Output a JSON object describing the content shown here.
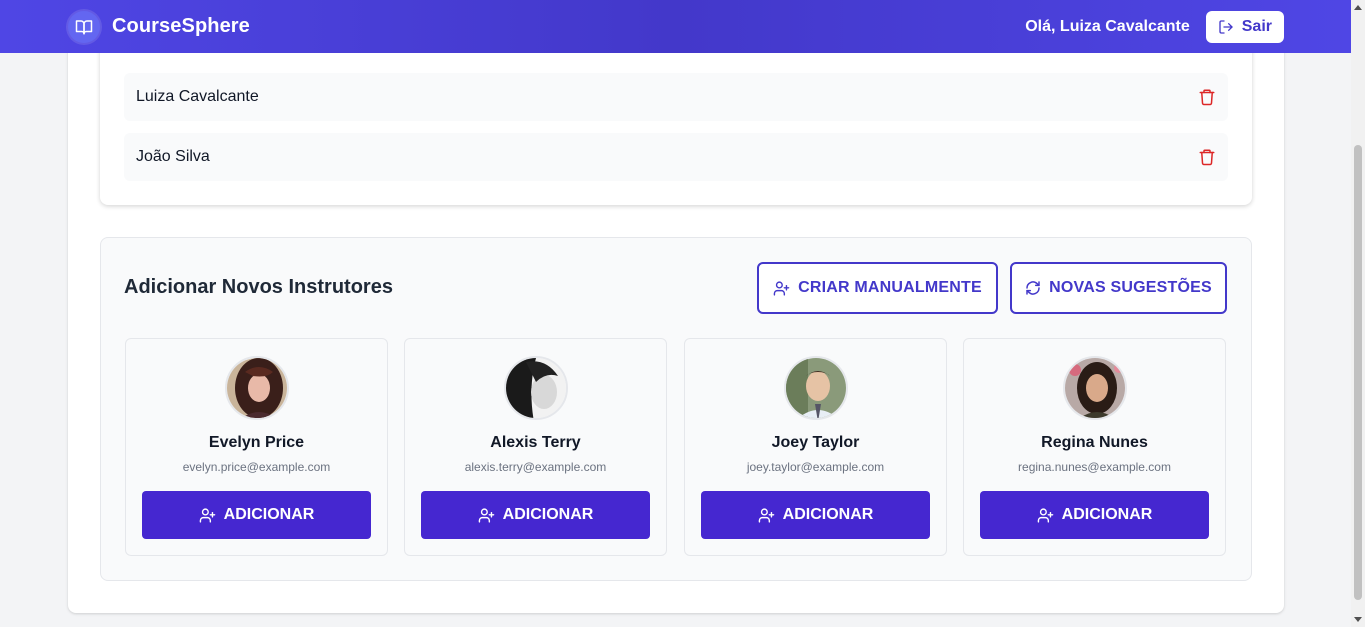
{
  "header": {
    "brand": "CourseSphere",
    "greeting": "Olá, Luiza Cavalcante",
    "logout_label": "Sair"
  },
  "team": {
    "members": [
      {
        "name": "Luiza Cavalcante"
      },
      {
        "name": "João Silva"
      }
    ]
  },
  "add_section": {
    "title": "Adicionar Novos Instrutores",
    "create_manual_label": "CRIAR MANUALMENTE",
    "new_suggestions_label": "NOVAS SUGESTÕES",
    "suggestions": [
      {
        "name": "Evelyn Price",
        "email": "evelyn.price@example.com",
        "button": "ADICIONAR"
      },
      {
        "name": "Alexis Terry",
        "email": "alexis.terry@example.com",
        "button": "ADICIONAR"
      },
      {
        "name": "Joey Taylor",
        "email": "joey.taylor@example.com",
        "button": "ADICIONAR"
      },
      {
        "name": "Regina Nunes",
        "email": "regina.nunes@example.com",
        "button": "ADICIONAR"
      }
    ]
  },
  "colors": {
    "primary": "#4338ca",
    "button": "#4527d0",
    "danger": "#dc2626"
  }
}
